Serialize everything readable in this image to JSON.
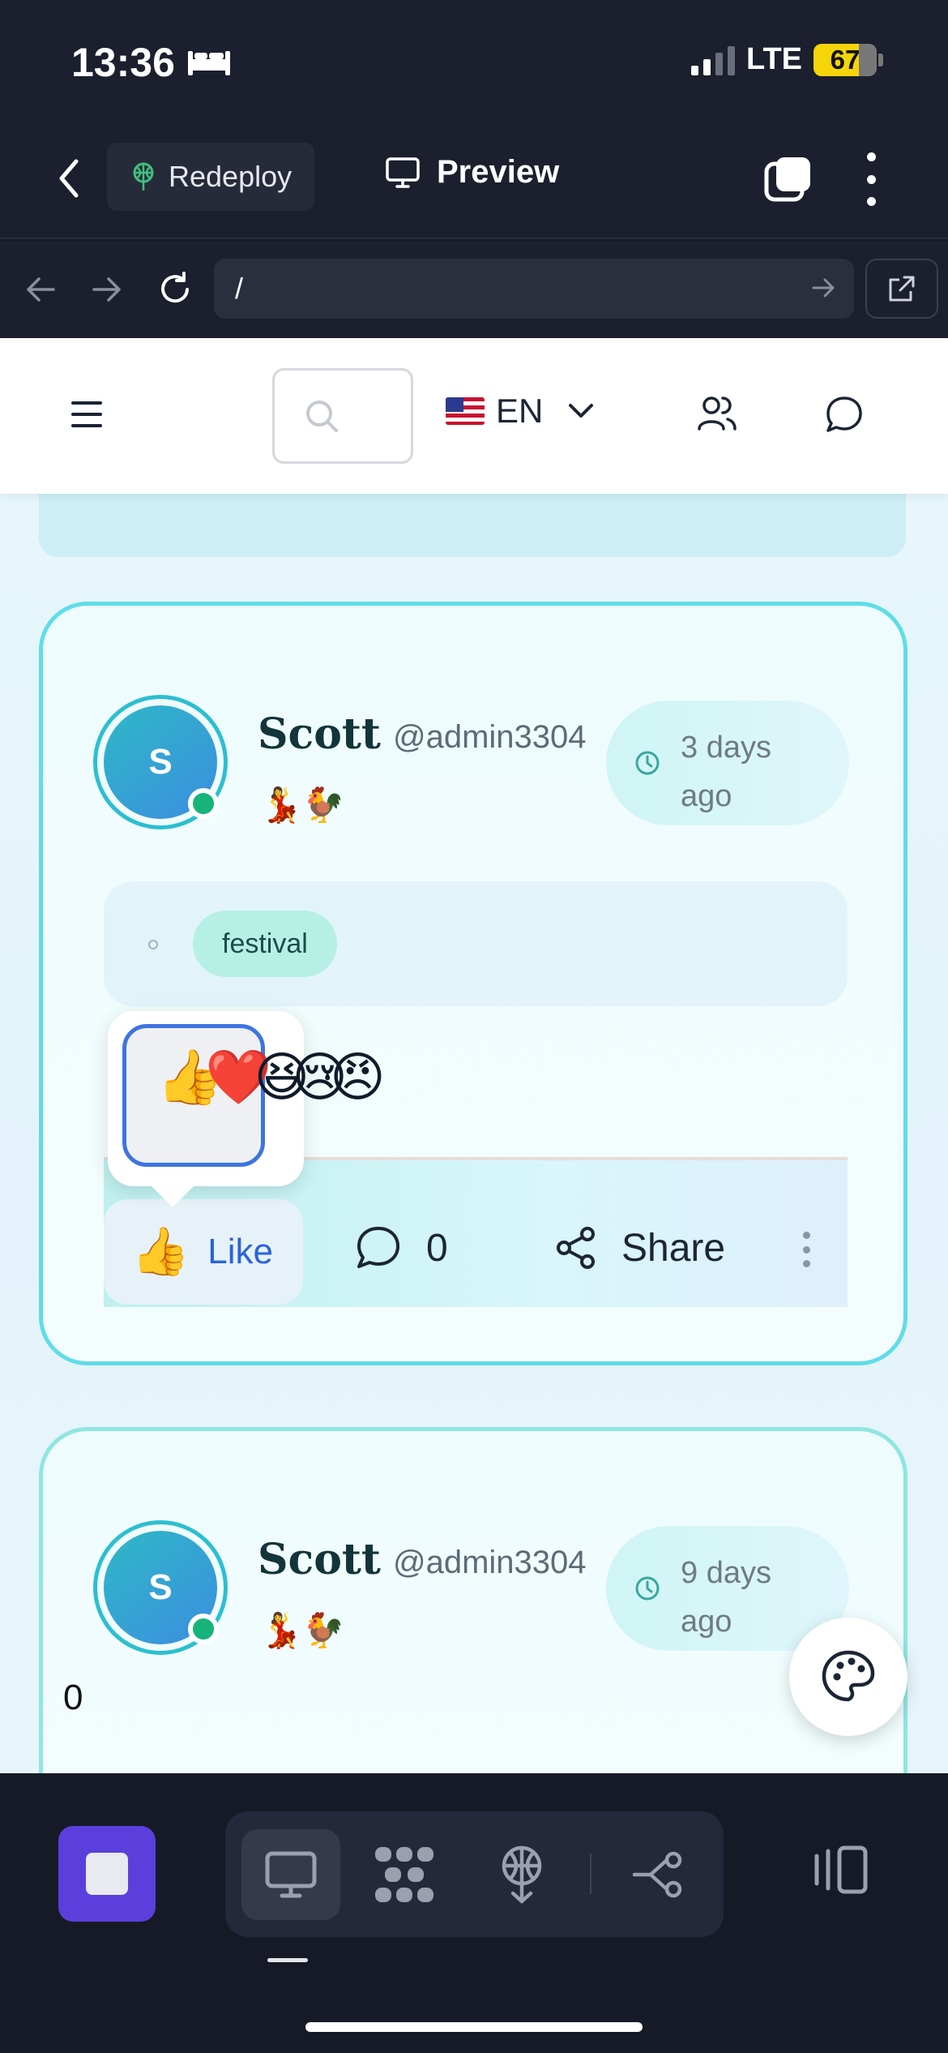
{
  "status_bar": {
    "time": "13:36",
    "network": "LTE",
    "battery": "67"
  },
  "app_toolbar": {
    "redeploy_label": "Redeploy",
    "preview_label": "Preview"
  },
  "browser": {
    "url": "/"
  },
  "site_header": {
    "language": "EN",
    "search_placeholder": ""
  },
  "posts": [
    {
      "avatar_letter": "S",
      "name": "Scott",
      "handle": "@admin3304",
      "time_line1": "3 days",
      "time_line2": "ago",
      "badge_emoji": "💃🐓",
      "tag": "festival",
      "reactions": [
        "👍",
        "❤️",
        "😆",
        "😢",
        "😠"
      ],
      "like_emoji": "👍",
      "like_label": "Like",
      "comment_count": "0",
      "share_label": "Share"
    },
    {
      "avatar_letter": "S",
      "name": "Scott",
      "handle": "@admin3304",
      "time_line1": "9 days",
      "time_line2": "ago",
      "badge_emoji": "💃🐓",
      "count": "0"
    }
  ],
  "icons": {
    "back": "chevron-left-icon",
    "redeploy": "rocket-icon",
    "preview": "monitor-icon",
    "tabs": "tabs-icon",
    "search": "search-icon",
    "users": "users-icon",
    "chat": "chat-icon",
    "clock": "clock-icon",
    "palette": "palette-icon"
  },
  "colors": {
    "accent_blue": "#2b63d9",
    "card_border": "#5fdde8",
    "stop_button": "#5b3fdc",
    "online": "#17b37a"
  }
}
